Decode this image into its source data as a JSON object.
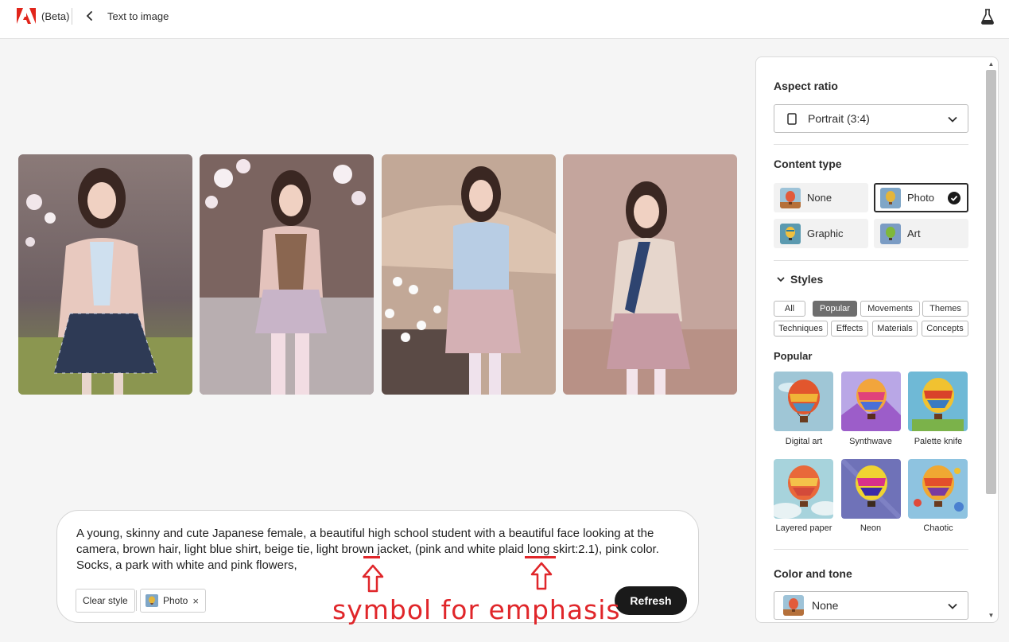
{
  "header": {
    "beta_label": "(Beta)",
    "title": "Text to image"
  },
  "gallery": {
    "images": [
      {
        "alt": "generated-image-1"
      },
      {
        "alt": "generated-image-2"
      },
      {
        "alt": "generated-image-3"
      },
      {
        "alt": "generated-image-4"
      }
    ]
  },
  "prompt": {
    "text": "A young, skinny and cute Japanese female, a beautiful high school student with a beautiful face looking at the camera, brown hair, light blue shirt, beige tie, light brown jacket, (pink and white plaid long skirt:2.1), pink color. Socks, a park with white and pink flowers,",
    "clear_style_label": "Clear style",
    "chip_label": "Photo",
    "chip_remove": "×",
    "refresh_label": "Refresh"
  },
  "annotation": {
    "text": "symbol for emphasis",
    "color": "#e0262a"
  },
  "panel": {
    "aspect_ratio": {
      "title": "Aspect ratio",
      "selected": "Portrait (3:4)"
    },
    "content_type": {
      "title": "Content type",
      "options": [
        {
          "label": "None",
          "selected": false
        },
        {
          "label": "Photo",
          "selected": true
        },
        {
          "label": "Graphic",
          "selected": false
        },
        {
          "label": "Art",
          "selected": false
        }
      ]
    },
    "styles": {
      "title": "Styles",
      "tags": [
        {
          "label": "All",
          "selected": false
        },
        {
          "label": "Popular",
          "selected": true
        },
        {
          "label": "Movements",
          "selected": false
        },
        {
          "label": "Themes",
          "selected": false
        },
        {
          "label": "Techniques",
          "selected": false
        },
        {
          "label": "Effects",
          "selected": false
        },
        {
          "label": "Materials",
          "selected": false
        },
        {
          "label": "Concepts",
          "selected": false
        }
      ],
      "subsection": "Popular",
      "items": [
        {
          "label": "Digital art"
        },
        {
          "label": "Synthwave"
        },
        {
          "label": "Palette knife"
        },
        {
          "label": "Layered paper"
        },
        {
          "label": "Neon"
        },
        {
          "label": "Chaotic"
        }
      ]
    },
    "color_tone": {
      "title": "Color and tone",
      "selected": "None"
    }
  }
}
